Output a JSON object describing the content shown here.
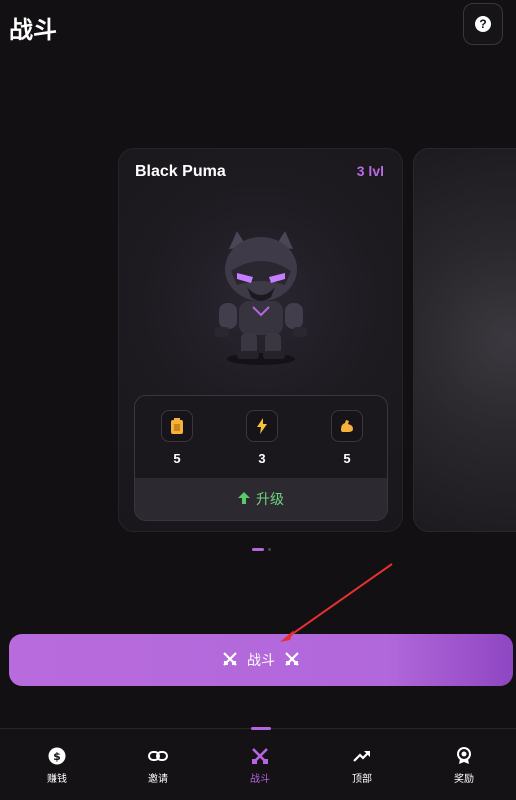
{
  "header": {
    "title": "战斗",
    "help_symbol": "?"
  },
  "card": {
    "name": "Black Puma",
    "level": "3 lvl",
    "stats": [
      {
        "icon": "battery-icon",
        "value": "5"
      },
      {
        "icon": "lightning-icon",
        "value": "3"
      },
      {
        "icon": "muscle-icon",
        "value": "5"
      }
    ],
    "upgrade_label": "升级"
  },
  "carousel": {
    "active_index": 0,
    "count": 2
  },
  "fight_button": {
    "label": "战斗"
  },
  "nav": {
    "items": [
      {
        "label": "赚钱",
        "icon": "dollar-icon"
      },
      {
        "label": "邀请",
        "icon": "link-icon"
      },
      {
        "label": "战斗",
        "icon": "crossed-swords-icon"
      },
      {
        "label": "顶部",
        "icon": "trending-up-icon"
      },
      {
        "label": "奖励",
        "icon": "medal-icon"
      }
    ],
    "active_index": 2
  },
  "colors": {
    "accent": "#b565df",
    "upgrade": "#6fd47e",
    "background": "#121013",
    "level": "#b76ce0"
  }
}
